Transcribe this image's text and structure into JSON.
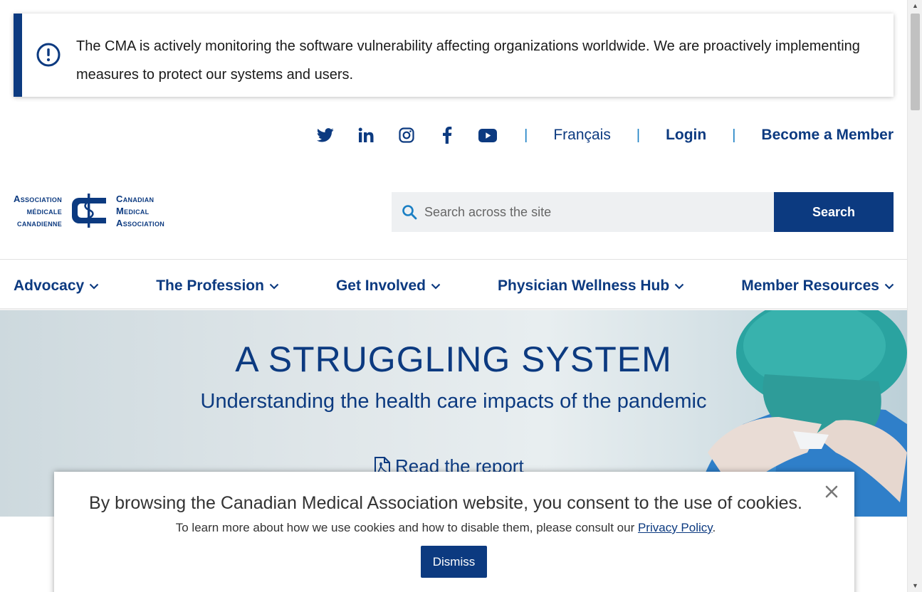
{
  "alert": {
    "message": "The CMA is actively monitoring the software vulnerability affecting organizations worldwide. We are proactively implementing measures to protect our systems and users."
  },
  "utility": {
    "social": [
      "twitter-icon",
      "linkedin-icon",
      "instagram-icon",
      "facebook-icon",
      "youtube-icon"
    ],
    "language": "Français",
    "login": "Login",
    "become_member": "Become a Member"
  },
  "logo": {
    "left_lines": [
      "Association",
      "médicale",
      "canadienne"
    ],
    "right_lines": [
      "Canadian",
      "Medical",
      "Association"
    ]
  },
  "search": {
    "placeholder": "Search across the site",
    "button": "Search"
  },
  "nav": {
    "items": [
      {
        "label": "Advocacy"
      },
      {
        "label": "The Profession"
      },
      {
        "label": "Get Involved"
      },
      {
        "label": "Physician Wellness Hub"
      },
      {
        "label": "Member Resources"
      }
    ]
  },
  "hero": {
    "title": "A STRUGGLING SYSTEM",
    "subtitle": "Understanding the health care impacts of the pandemic",
    "link": "Read the report"
  },
  "cookie": {
    "title": "By browsing the Canadian Medical Association website, you consent to the use of cookies.",
    "text": "To learn more about how we use cookies and how to disable them, please consult our",
    "link": "Privacy Policy",
    "end": ".",
    "dismiss": "Dismiss"
  },
  "colors": {
    "brand": "#0c3a80",
    "accent": "#1a7fc4"
  }
}
